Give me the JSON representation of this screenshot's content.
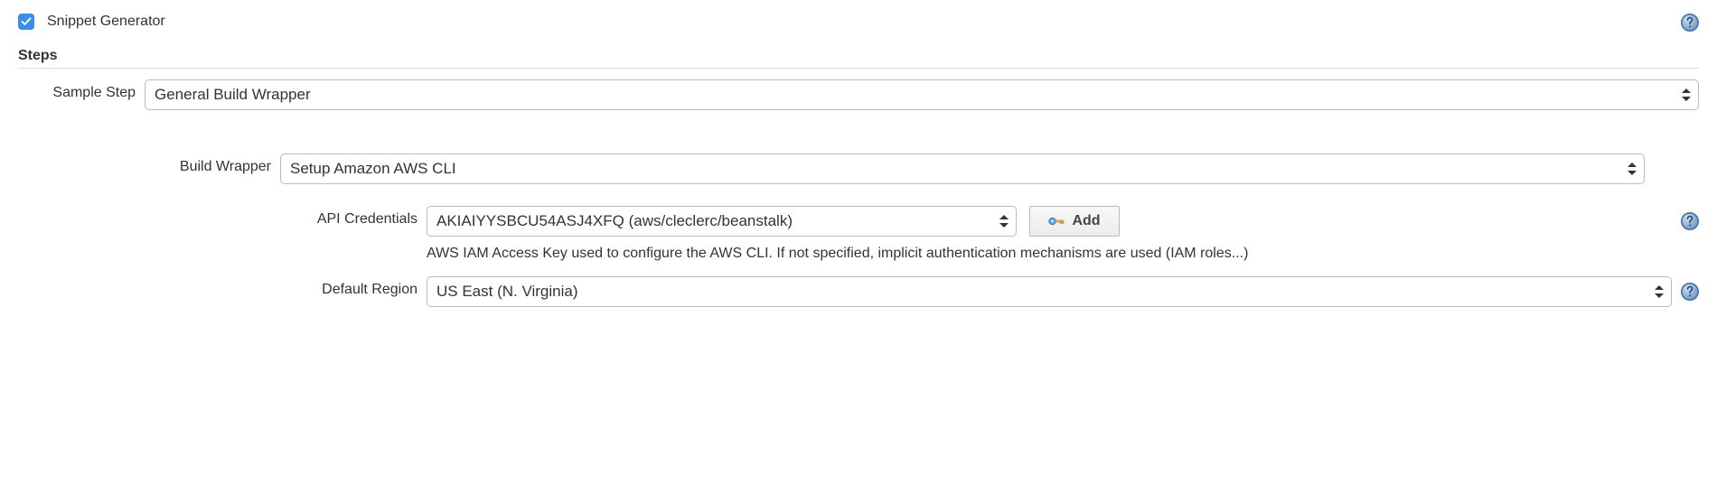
{
  "snippetGenerator": {
    "label": "Snippet Generator",
    "checked": true
  },
  "stepsHeading": "Steps",
  "sampleStep": {
    "label": "Sample Step",
    "value": "General Build Wrapper"
  },
  "buildWrapper": {
    "label": "Build Wrapper",
    "value": "Setup Amazon AWS CLI"
  },
  "apiCredentials": {
    "label": "API Credentials",
    "value": "AKIAIYYSBCU54ASJ4XFQ (aws/cleclerc/beanstalk)",
    "add": "Add",
    "description": "AWS IAM Access Key used to configure the AWS CLI. If not specified, implicit authentication mechanisms are used (IAM roles...)"
  },
  "defaultRegion": {
    "label": "Default Region",
    "value": "US East (N. Virginia)"
  }
}
